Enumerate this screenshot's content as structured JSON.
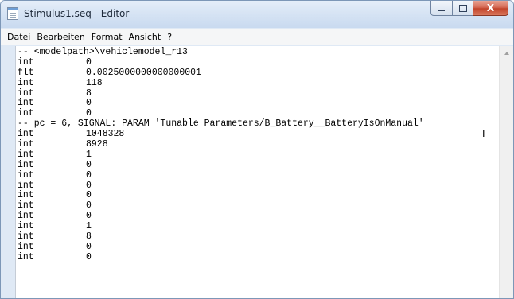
{
  "window": {
    "title": "Stimulus1.seq - Editor",
    "close_label": "X"
  },
  "menu": [
    "Datei",
    "Bearbeiten",
    "Format",
    "Ansicht",
    "?"
  ],
  "lines": [
    {
      "type": "comment",
      "text": "-- <modelpath>\\vehiclemodel_r13"
    },
    {
      "type": "kv",
      "key": "int",
      "value": "0"
    },
    {
      "type": "kv",
      "key": "flt",
      "value": "0.0025000000000000001"
    },
    {
      "type": "kv",
      "key": "int",
      "value": "118"
    },
    {
      "type": "kv",
      "key": "int",
      "value": "8"
    },
    {
      "type": "kv",
      "key": "int",
      "value": "0"
    },
    {
      "type": "kv",
      "key": "int",
      "value": "0"
    },
    {
      "type": "comment",
      "text": "-- pc = 6, SIGNAL: PARAM 'Tunable Parameters/B_Battery__BatteryIsOnManual'"
    },
    {
      "type": "kv",
      "key": "int",
      "value": "1048328"
    },
    {
      "type": "kv",
      "key": "int",
      "value": "8928"
    },
    {
      "type": "kv",
      "key": "int",
      "value": "1"
    },
    {
      "type": "kv",
      "key": "int",
      "value": "0"
    },
    {
      "type": "kv",
      "key": "int",
      "value": "0"
    },
    {
      "type": "kv",
      "key": "int",
      "value": "0"
    },
    {
      "type": "kv",
      "key": "int",
      "value": "0"
    },
    {
      "type": "kv",
      "key": "int",
      "value": "0"
    },
    {
      "type": "kv",
      "key": "int",
      "value": "0"
    },
    {
      "type": "kv",
      "key": "int",
      "value": "1"
    },
    {
      "type": "kv",
      "key": "int",
      "value": "8"
    },
    {
      "type": "kv",
      "key": "int",
      "value": "0"
    },
    {
      "type": "kv",
      "key": "int",
      "value": "0"
    }
  ],
  "icons": {
    "app": "notepad-icon",
    "minimize": "minimize-icon",
    "maximize": "maximize-icon",
    "close": "close-icon",
    "scroll_up": "arrow-up-icon",
    "text_cursor": "ibeam-cursor-icon"
  },
  "colors": {
    "titlebar": "#d7e4f4",
    "close_button": "#c1432a",
    "editor_background": "#ffffff"
  }
}
